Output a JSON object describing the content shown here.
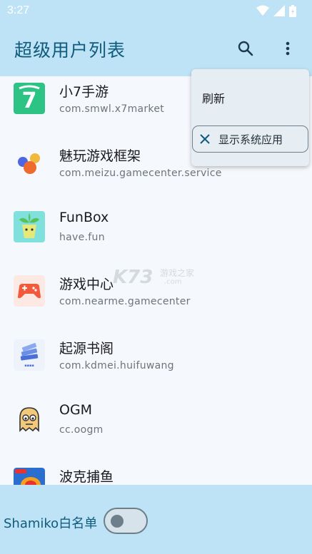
{
  "status_bar": {
    "time": "3:27"
  },
  "app_bar": {
    "title": "超级用户列表",
    "search_icon": "search-icon",
    "more_icon": "more-vert-icon"
  },
  "apps": [
    {
      "name": "小7手游",
      "package": "com.smwl.x7market",
      "icon": "x7-icon"
    },
    {
      "name": "魅玩游戏框架",
      "package": "com.meizu.gamecenter.service",
      "icon": "meizu-icon"
    },
    {
      "name": "FunBox",
      "package": "have.fun",
      "icon": "funbox-icon"
    },
    {
      "name": "游戏中心",
      "package": "com.nearme.gamecenter",
      "icon": "gamecenter-icon"
    },
    {
      "name": "起源书阁",
      "package": "com.kdmei.huifuwang",
      "icon": "books-icon"
    },
    {
      "name": "OGM",
      "package": "cc.oogm",
      "icon": "ogm-icon"
    },
    {
      "name": "波克捕鱼",
      "package": "",
      "icon": "fishing-icon"
    }
  ],
  "menu": {
    "refresh_label": "刷新",
    "show_system_label": "显示系统应用",
    "show_system_selected": true
  },
  "bottom_bar": {
    "shamiko_label": "Shamiko白名单",
    "shamiko_enabled": false
  },
  "watermark": {
    "brand": "K73",
    "text": "游戏之家",
    "url": ".com"
  },
  "colors": {
    "app_bar_bg": "#bfe3f6",
    "title_color": "#0f5b7c",
    "background": "#f5f8fc"
  }
}
